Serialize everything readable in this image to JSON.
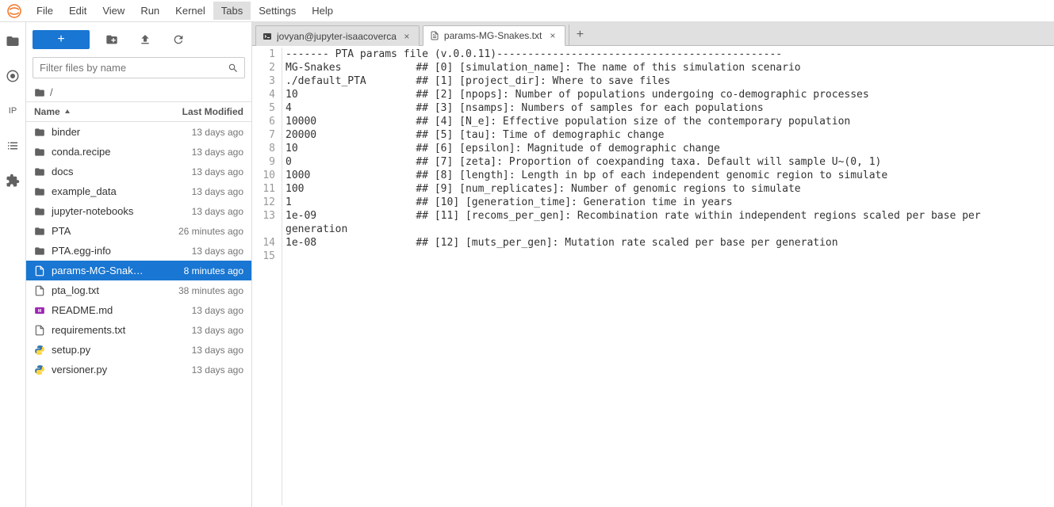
{
  "menu": {
    "items": [
      "File",
      "Edit",
      "View",
      "Run",
      "Kernel",
      "Tabs",
      "Settings",
      "Help"
    ],
    "active_index": 5
  },
  "activity_bar": {
    "icons": [
      "folder-icon",
      "target-icon",
      "ip-icon",
      "list-icon",
      "puzzle-icon"
    ],
    "ip_label": "IP"
  },
  "file_toolbar": {
    "new_label": "+",
    "icons": [
      "new-folder-icon",
      "upload-icon",
      "refresh-icon"
    ]
  },
  "filter": {
    "placeholder": "Filter files by name"
  },
  "breadcrumb": {
    "path": "/"
  },
  "file_header": {
    "name": "Name",
    "modified": "Last Modified"
  },
  "files": [
    {
      "icon": "folder",
      "name": "binder",
      "modified": "13 days ago",
      "selected": false
    },
    {
      "icon": "folder",
      "name": "conda.recipe",
      "modified": "13 days ago",
      "selected": false
    },
    {
      "icon": "folder",
      "name": "docs",
      "modified": "13 days ago",
      "selected": false
    },
    {
      "icon": "folder",
      "name": "example_data",
      "modified": "13 days ago",
      "selected": false
    },
    {
      "icon": "folder",
      "name": "jupyter-notebooks",
      "modified": "13 days ago",
      "selected": false
    },
    {
      "icon": "folder",
      "name": "PTA",
      "modified": "26 minutes ago",
      "selected": false
    },
    {
      "icon": "folder",
      "name": "PTA.egg-info",
      "modified": "13 days ago",
      "selected": false
    },
    {
      "icon": "file",
      "name": "params-MG-Snak…",
      "modified": "8 minutes ago",
      "selected": true
    },
    {
      "icon": "file",
      "name": "pta_log.txt",
      "modified": "38 minutes ago",
      "selected": false
    },
    {
      "icon": "markdown",
      "name": "README.md",
      "modified": "13 days ago",
      "selected": false
    },
    {
      "icon": "file",
      "name": "requirements.txt",
      "modified": "13 days ago",
      "selected": false
    },
    {
      "icon": "python",
      "name": "setup.py",
      "modified": "13 days ago",
      "selected": false
    },
    {
      "icon": "python",
      "name": "versioner.py",
      "modified": "13 days ago",
      "selected": false
    }
  ],
  "tabs": [
    {
      "icon": "terminal",
      "label": "jovyan@jupyter-isaacoverca",
      "active": false
    },
    {
      "icon": "file",
      "label": "params-MG-Snakes.txt",
      "active": true
    }
  ],
  "editor": {
    "lines": [
      "------- PTA params file (v.0.0.11)----------------------------------------------",
      "MG-Snakes            ## [0] [simulation_name]: The name of this simulation scenario",
      "./default_PTA        ## [1] [project_dir]: Where to save files",
      "10                   ## [2] [npops]: Number of populations undergoing co-demographic processes",
      "4                    ## [3] [nsamps]: Numbers of samples for each populations",
      "10000                ## [4] [N_e]: Effective population size of the contemporary population",
      "20000                ## [5] [tau]: Time of demographic change",
      "10                   ## [6] [epsilon]: Magnitude of demographic change",
      "0                    ## [7] [zeta]: Proportion of coexpanding taxa. Default will sample U~(0, 1)",
      "1000                 ## [8] [length]: Length in bp of each independent genomic region to simulate",
      "100                  ## [9] [num_replicates]: Number of genomic regions to simulate",
      "1                    ## [10] [generation_time]: Generation time in years",
      "1e-09                ## [11] [recoms_per_gen]: Recombination rate within independent regions scaled per base per generation",
      "1e-08                ## [12] [muts_per_gen]: Mutation rate scaled per base per generation",
      ""
    ]
  }
}
